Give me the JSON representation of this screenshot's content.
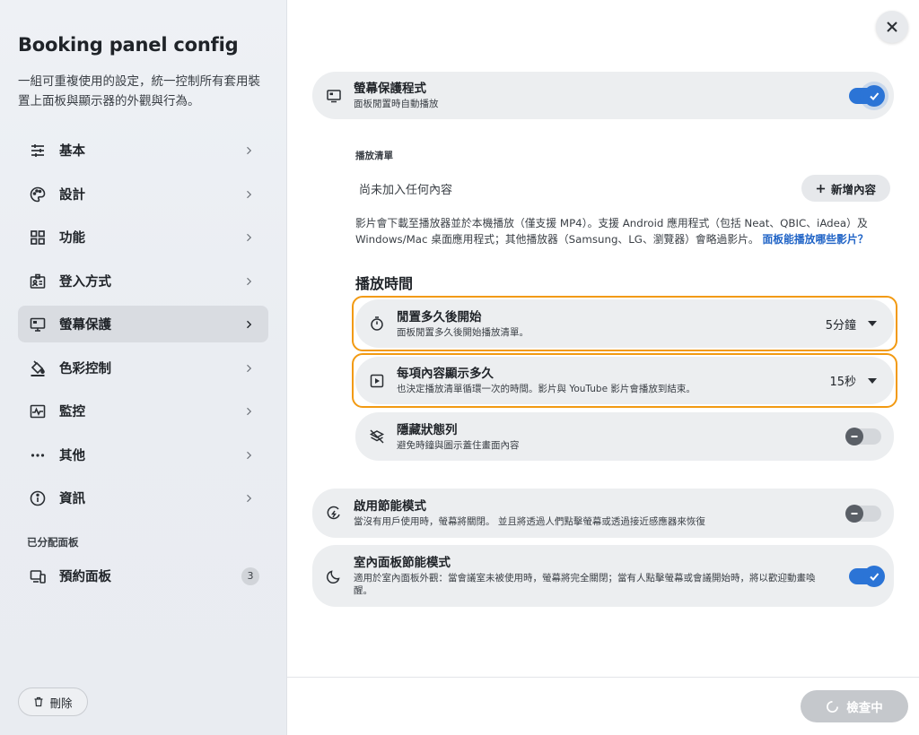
{
  "sidebar": {
    "title": "Booking panel config",
    "description": "一組可重複使用的設定，統一控制所有套用裝置上面板與顯示器的外觀與行為。",
    "items": [
      {
        "label": "基本",
        "icon": "sliders-icon"
      },
      {
        "label": "設計",
        "icon": "palette-icon"
      },
      {
        "label": "功能",
        "icon": "grid-icon"
      },
      {
        "label": "登入方式",
        "icon": "badge-icon"
      },
      {
        "label": "螢幕保護",
        "icon": "monitor-icon"
      },
      {
        "label": "色彩控制",
        "icon": "paint-bucket-icon"
      },
      {
        "label": "監控",
        "icon": "activity-icon"
      },
      {
        "label": "其他",
        "icon": "more-icon"
      },
      {
        "label": "資訊",
        "icon": "info-icon"
      }
    ],
    "active_index": 4,
    "assigned_section": "已分配面板",
    "assigned": {
      "label": "預約面板",
      "count": "3",
      "icon": "devices-icon"
    },
    "delete_label": "刪除"
  },
  "main": {
    "screensaver": {
      "title": "螢幕保護程式",
      "subtitle": "面板閒置時自動播放",
      "enabled": true
    },
    "playlist_label": "播放清單",
    "playlist_empty": "尚未加入任何內容",
    "add_content_label": "新增內容",
    "info_text": "影片會下載至播放器並於本機播放（僅支援 MP4）。支援 Android 應用程式（包括 Neat、QBIC、iAdea）及 Windows/Mac 桌面應用程式；其他播放器（Samsung、LG、瀏覽器）會略過影片。",
    "info_link": "面板能播放哪些影片？",
    "playback_section": "播放時間",
    "idle_start": {
      "title": "閒置多久後開始",
      "subtitle": "面板閒置多久後開始播放清單。",
      "value": "5分鐘"
    },
    "per_item": {
      "title": "每項內容顯示多久",
      "subtitle": "也決定播放清單循環一次的時間。影片與 YouTube 影片會播放到結束。",
      "value": "15秒"
    },
    "hide_status": {
      "title": "隱藏狀態列",
      "subtitle": "避免時鐘與圖示蓋住畫面內容",
      "enabled": false
    },
    "power_saving": {
      "title": "啟用節能模式",
      "subtitle": "當沒有用戶使用時，螢幕將關閉。 並且將透過人們點擊螢幕或透過接近感應器來恢復",
      "enabled": false
    },
    "indoor_saving": {
      "title": "室內面板節能模式",
      "subtitle": "適用於室內面板外觀：當會議室未被使用時，螢幕將完全關閉；當有人點擊螢幕或會議開始時，將以歡迎動畫喚醒。",
      "enabled": true
    },
    "checking_label": "檢查中"
  },
  "colors": {
    "accent": "#2b74d6",
    "highlight": "#f29a12",
    "link": "#1f63c6"
  }
}
